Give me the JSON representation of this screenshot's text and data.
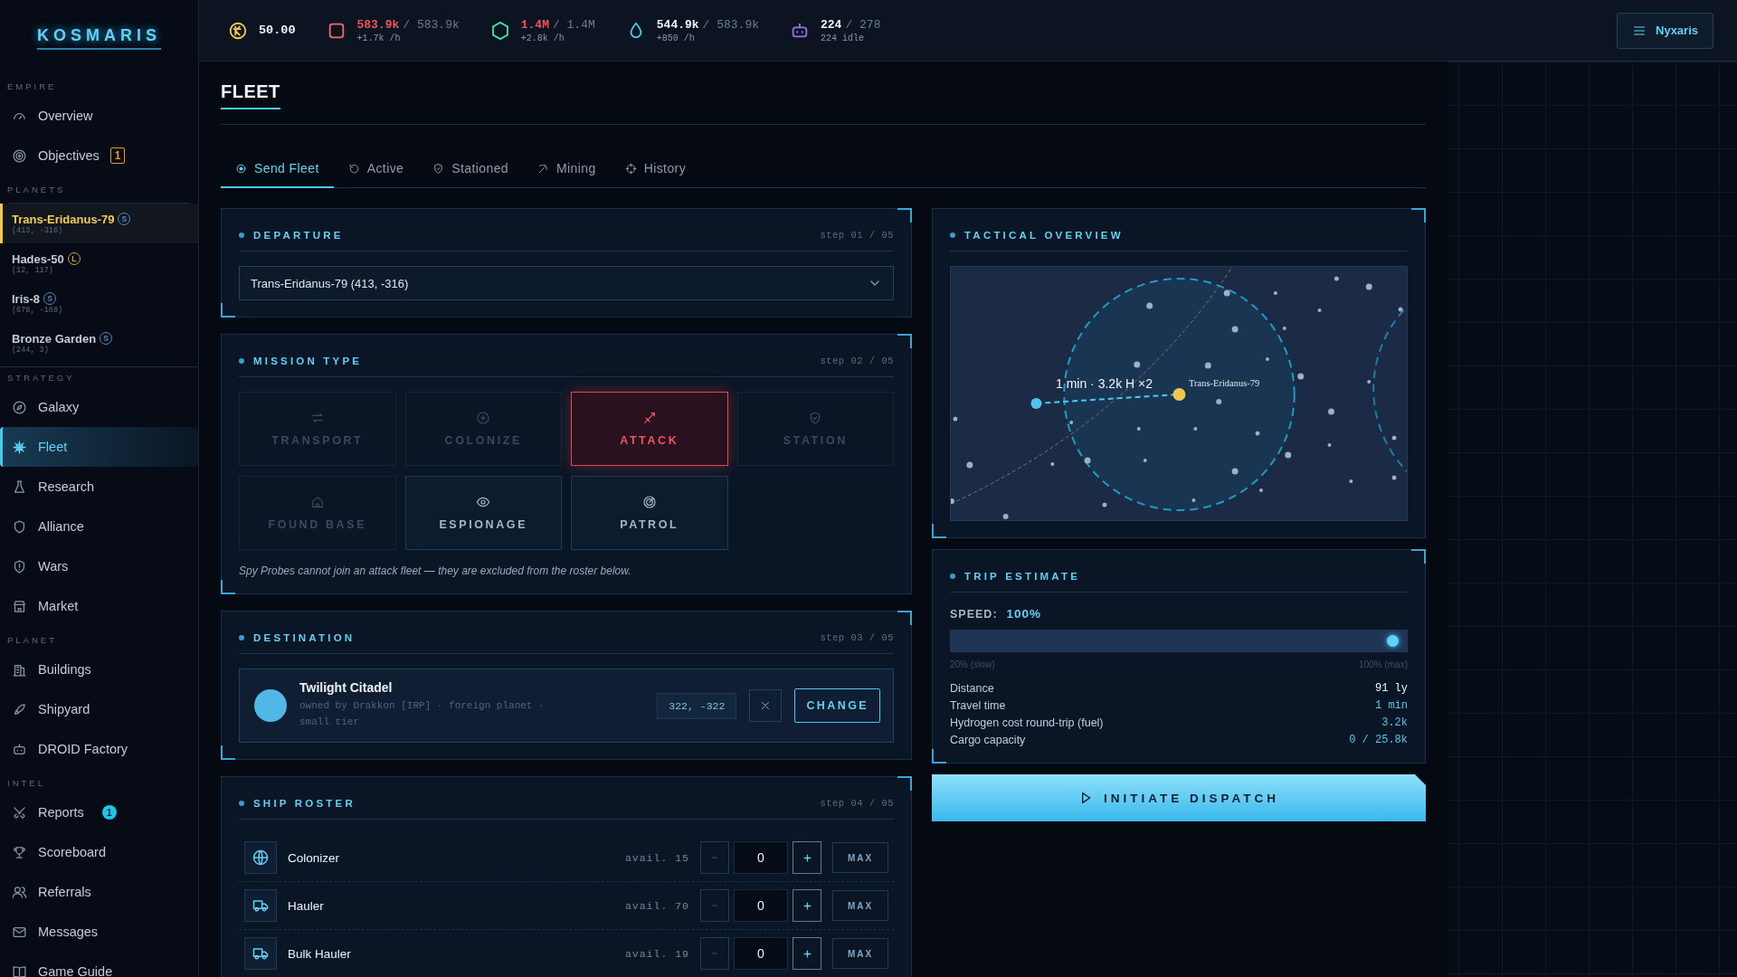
{
  "sidebar": {
    "logo": "KOSMARIS",
    "sections": [
      {
        "heading": "EMPIRE",
        "items": [
          {
            "kind": "nav",
            "label": "Overview",
            "selected": false
          },
          {
            "kind": "nav",
            "label": "Objectives",
            "selected": false,
            "badge": {
              "kind": "outline",
              "text": "1"
            }
          }
        ]
      },
      {
        "heading": "PLANETS",
        "items": [
          {
            "kind": "planet",
            "label": "Trans-Eridanus-79",
            "coords": "(413, -316)",
            "tag": {
              "text": "S",
              "color": "#4a8cc4"
            },
            "selected": true
          },
          {
            "kind": "planet",
            "label": "Hades-50",
            "coords": "(12, 117)",
            "tag": {
              "text": "L",
              "color": "#c9a040"
            },
            "selected": false
          },
          {
            "kind": "planet",
            "label": "Iris-8",
            "coords": "(678, -168)",
            "tag": {
              "text": "S",
              "color": "#4a8cc4"
            },
            "selected": false
          },
          {
            "kind": "planet",
            "label": "Bronze Garden",
            "coords": "(244, 3)",
            "tag": {
              "text": "S",
              "color": "#4a8cc4"
            },
            "selected": false
          }
        ]
      },
      {
        "heading": "STRATEGY",
        "items": [
          {
            "kind": "nav",
            "label": "Galaxy",
            "selected": false
          },
          {
            "kind": "nav",
            "label": "Fleet",
            "selected": true
          },
          {
            "kind": "nav",
            "label": "Research",
            "selected": false
          },
          {
            "kind": "nav",
            "label": "Alliance",
            "selected": false
          },
          {
            "kind": "nav",
            "label": "Wars",
            "selected": false
          },
          {
            "kind": "nav",
            "label": "Market",
            "selected": false
          }
        ]
      },
      {
        "heading": "PLANET",
        "items": [
          {
            "kind": "nav",
            "label": "Buildings",
            "selected": false
          },
          {
            "kind": "nav",
            "label": "Shipyard",
            "selected": false
          },
          {
            "kind": "nav",
            "label": "DROID Factory",
            "selected": false
          }
        ]
      },
      {
        "heading": "INTEL",
        "items": [
          {
            "kind": "nav",
            "label": "Reports",
            "selected": false,
            "badge": {
              "kind": "filled",
              "text": "1"
            }
          },
          {
            "kind": "nav",
            "label": "Scoreboard",
            "selected": false
          },
          {
            "kind": "nav",
            "label": "Referrals",
            "selected": false
          },
          {
            "kind": "nav",
            "label": "Messages",
            "selected": false
          },
          {
            "kind": "nav",
            "label": "Game Guide",
            "selected": false
          }
        ]
      }
    ]
  },
  "resources": [
    {
      "kind": "credits",
      "amount": "50.00"
    },
    {
      "kind": "metal",
      "amount": "583.9k",
      "capacity": "/ 583.9k",
      "rate": "+1.7k /h",
      "full": true
    },
    {
      "kind": "crystal",
      "amount": "1.4M",
      "capacity": "/ 1.4M",
      "rate": "+2.8k /h",
      "full": true
    },
    {
      "kind": "hydrogen",
      "amount": "544.9k",
      "capacity": "/ 583.9k",
      "rate": "+850 /h",
      "full": false
    },
    {
      "kind": "droids",
      "amount": "224",
      "capacity": "/ 278",
      "rate": "224 idle",
      "full": false
    }
  ],
  "user_menu": {
    "label": "Nyxaris"
  },
  "page_title": "FLEET",
  "tabs": [
    {
      "label": "Send Fleet",
      "selected": true
    },
    {
      "label": "Active",
      "selected": false
    },
    {
      "label": "Stationed",
      "selected": false
    },
    {
      "label": "Mining",
      "selected": false
    },
    {
      "label": "History",
      "selected": false
    }
  ],
  "departure": {
    "title": "DEPARTURE",
    "step": "step 01 / 05",
    "value": "Trans-Eridanus-79 (413, -316)"
  },
  "mission": {
    "title": "MISSION TYPE",
    "step": "step 02 / 05",
    "types": [
      {
        "label": "TRANSPORT",
        "disabled": true,
        "selected": false
      },
      {
        "label": "COLONIZE",
        "disabled": true,
        "selected": false
      },
      {
        "label": "ATTACK",
        "disabled": false,
        "selected": true
      },
      {
        "label": "STATION",
        "disabled": true,
        "selected": false
      },
      {
        "label": "FOUND BASE",
        "disabled": true,
        "selected": false
      },
      {
        "label": "ESPIONAGE",
        "disabled": false,
        "selected": false
      },
      {
        "label": "PATROL",
        "disabled": false,
        "selected": false
      }
    ],
    "note": "Spy Probes cannot join an attack fleet — they are excluded from the roster below."
  },
  "destination": {
    "title": "DESTINATION",
    "step": "step 03 / 05",
    "name": "Twilight Citadel",
    "color": "#4fb8e6",
    "details": "owned by Drakkon [IRP] · foreign planet · small tier",
    "coords": "322, -322",
    "action": "CHANGE"
  },
  "roster": {
    "title": "SHIP ROSTER",
    "step": "step 04 / 05",
    "ships": [
      {
        "name": "Colonizer",
        "available": "avail. 15",
        "count": "0",
        "max": "MAX"
      },
      {
        "name": "Hauler",
        "available": "avail. 70",
        "count": "0",
        "max": "MAX"
      },
      {
        "name": "Bulk Hauler",
        "available": "avail. 19",
        "count": "0",
        "max": "MAX"
      }
    ]
  },
  "tactical": {
    "title": "TACTICAL OVERVIEW",
    "route_label": "1 min · 3.2k H ×2",
    "origin_label": "Trans-Eridanus-79"
  },
  "trip": {
    "title": "TRIP ESTIMATE",
    "speed_label": "SPEED:",
    "speed_value": "100%",
    "speed": {
      "level": 1,
      "min_label": "20% (slow)",
      "max_label": "100% (max)"
    },
    "stats": [
      {
        "label": "Distance",
        "value": "91 ly",
        "accent": false
      },
      {
        "label": "Travel time",
        "value": "1 min",
        "accent": true
      },
      {
        "label": "Hydrogen cost round-trip (fuel)",
        "value": "3.2k",
        "accent": true
      },
      {
        "label": "Cargo capacity",
        "value": "0 / 25.8k",
        "accent": true
      }
    ]
  },
  "dispatch": {
    "label": "INITIATE DISPATCH"
  }
}
